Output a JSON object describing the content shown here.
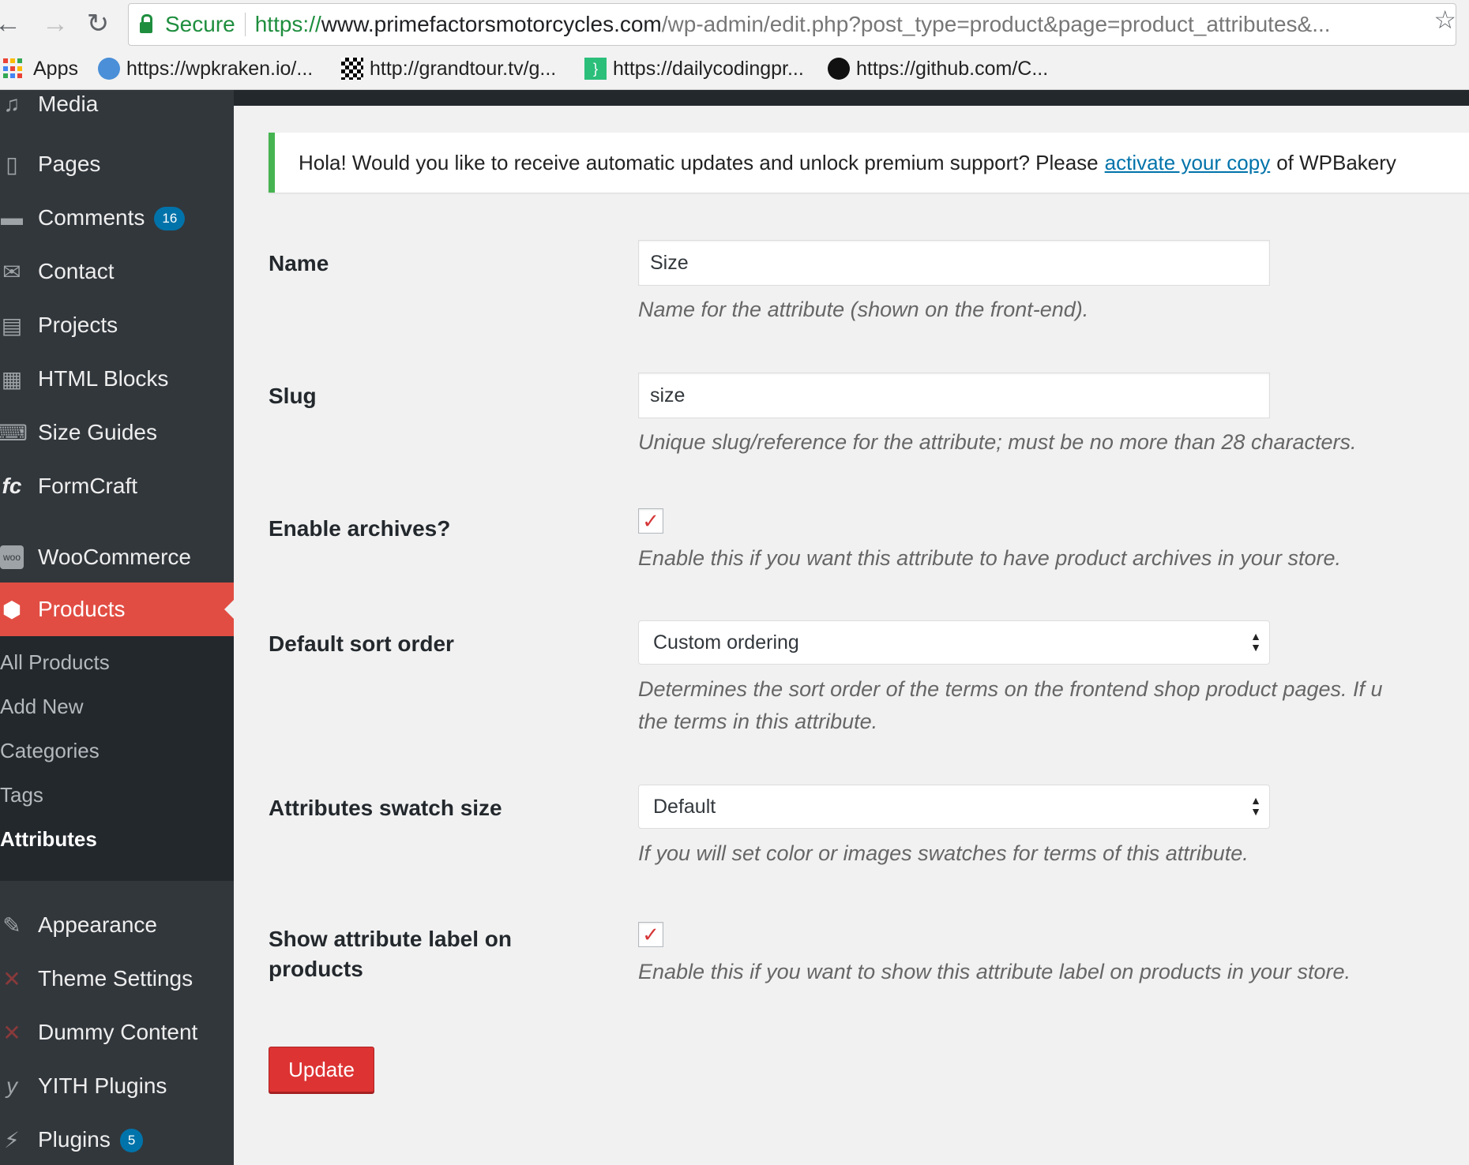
{
  "browser": {
    "secure_label": "Secure",
    "url_scheme": "https://",
    "url_host": "www.primefactorsmotorcycles.com",
    "url_path": "/wp-admin/edit.php?post_type=product&page=product_attributes&...",
    "bookmarks": [
      {
        "label": "Apps"
      },
      {
        "label": "https://wpkraken.io/..."
      },
      {
        "label": "http://grandtour.tv/g..."
      },
      {
        "label": "https://dailycodingpr..."
      },
      {
        "label": "https://github.com/C..."
      }
    ]
  },
  "sidebar": {
    "items": [
      {
        "label": "Media"
      },
      {
        "label": "Pages"
      },
      {
        "label": "Comments",
        "badge": "16"
      },
      {
        "label": "Contact"
      },
      {
        "label": "Projects"
      },
      {
        "label": "HTML Blocks"
      },
      {
        "label": "Size Guides"
      },
      {
        "label": "FormCraft"
      },
      {
        "label": "WooCommerce"
      },
      {
        "label": "Products"
      },
      {
        "label": "Appearance"
      },
      {
        "label": "Theme Settings"
      },
      {
        "label": "Dummy Content"
      },
      {
        "label": "YITH Plugins"
      },
      {
        "label": "Plugins",
        "badge": "5"
      }
    ],
    "submenu": [
      "All Products",
      "Add New",
      "Categories",
      "Tags",
      "Attributes"
    ]
  },
  "notice": {
    "before": "Hola! Would you like to receive automatic updates and unlock premium support? Please",
    "link": "activate your copy",
    "after": "of WPBakery"
  },
  "form": {
    "name": {
      "label": "Name",
      "value": "Size",
      "desc": "Name for the attribute (shown on the front-end)."
    },
    "slug": {
      "label": "Slug",
      "value": "size",
      "desc": "Unique slug/reference for the attribute; must be no more than 28 characters."
    },
    "archives": {
      "label": "Enable archives?",
      "checked": true,
      "desc": "Enable this if you want this attribute to have product archives in your store."
    },
    "sort": {
      "label": "Default sort order",
      "value": "Custom ordering",
      "desc_line1": "Determines the sort order of the terms on the frontend shop product pages. If u",
      "desc_line2": "the terms in this attribute."
    },
    "swatch": {
      "label": "Attributes swatch size",
      "value": "Default",
      "desc": "If you will set color or images swatches for terms of this attribute."
    },
    "show_label": {
      "label_line1": "Show attribute label on",
      "label_line2": "products",
      "checked": true,
      "desc": "Enable this if you want to show this attribute label on products in your store."
    },
    "update_label": "Update"
  },
  "colors": {
    "accent": "#e14d43",
    "link": "#0073aa",
    "notice_border": "#46b450",
    "button": "#dd3333"
  }
}
